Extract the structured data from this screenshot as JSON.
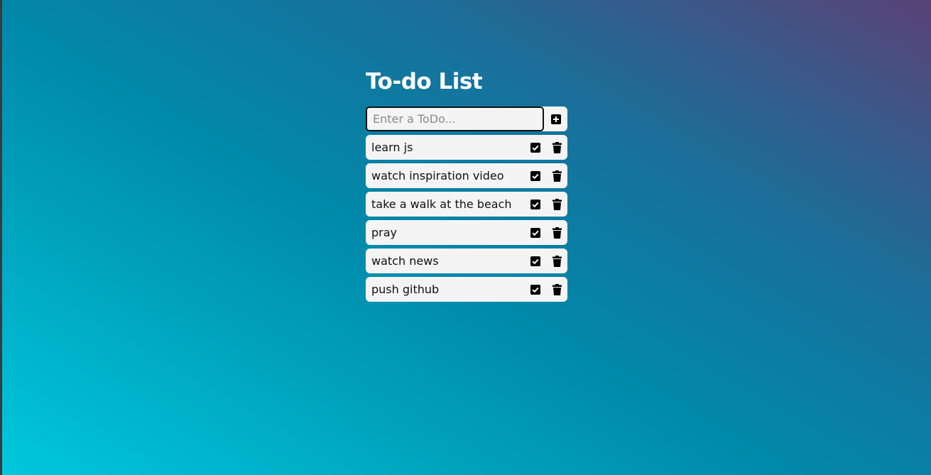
{
  "app": {
    "title": "To-do List"
  },
  "input": {
    "placeholder": "Enter a ToDo...",
    "value": "",
    "add_icon": "plus-square-icon"
  },
  "todos": [
    {
      "text": "learn js"
    },
    {
      "text": "watch inspiration video"
    },
    {
      "text": "take a walk at the beach"
    },
    {
      "text": "pray"
    },
    {
      "text": "watch news"
    },
    {
      "text": "push github"
    }
  ],
  "icons": {
    "complete": "check-square-icon",
    "delete": "trash-icon"
  },
  "colors": {
    "gradient_start": "#00c8dc",
    "gradient_mid": "#0089aa",
    "gradient_end": "#5a4277",
    "item_background": "#f4f4f4",
    "title": "#ffffff"
  }
}
